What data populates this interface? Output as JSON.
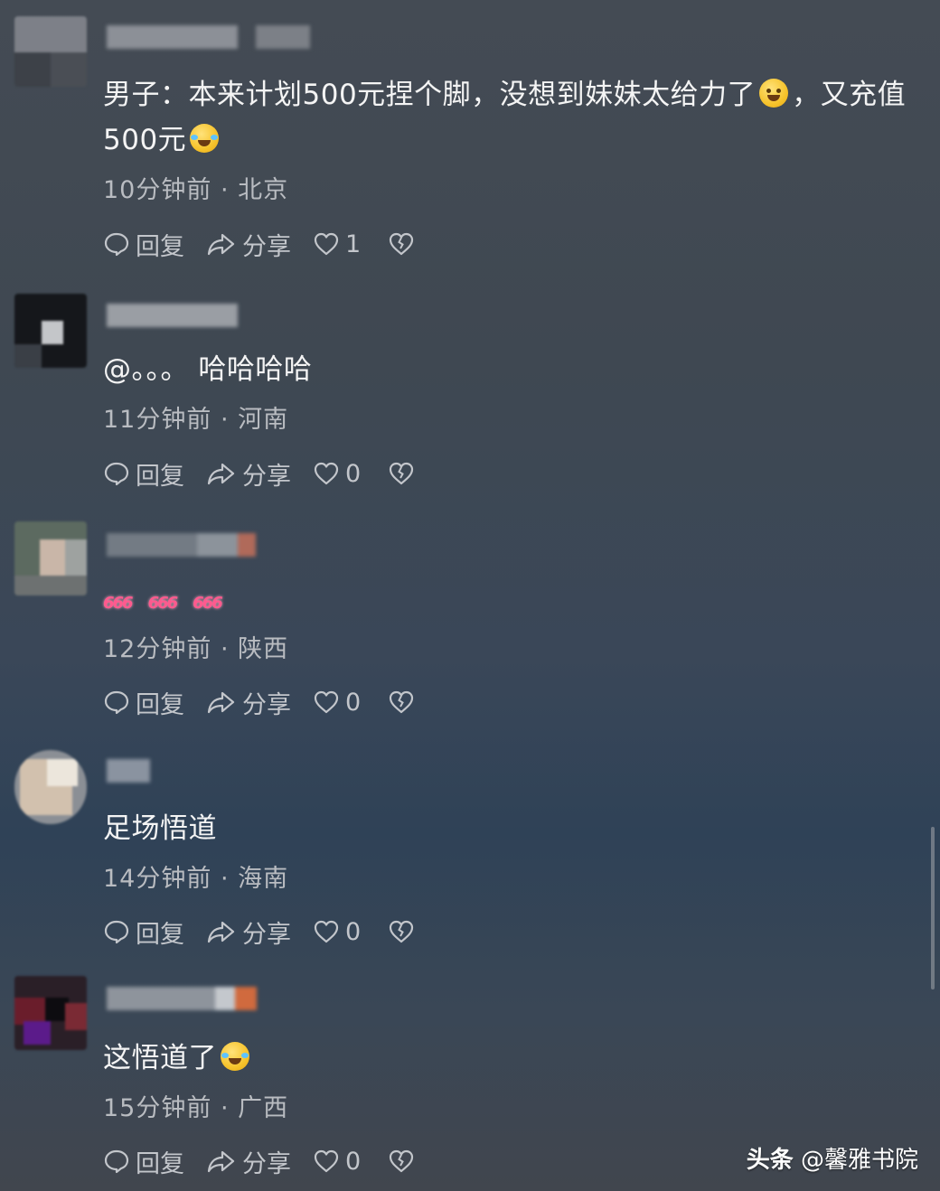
{
  "comments": [
    {
      "text": "男子：本来计划500元捏个脚，没想到妹妹太给力了",
      "text_tail": "，又充值500元",
      "emoji_mid": "sweat-smile-emoji",
      "emoji_end": "laugh-cry-emoji",
      "meta": "10分钟前 · 北京",
      "reply": "回复",
      "share": "分享",
      "likes": "1"
    },
    {
      "text": "@。。。 哈哈哈哈",
      "meta": "11分钟前 · 河南",
      "reply": "回复",
      "share": "分享",
      "likes": "0"
    },
    {
      "sticker": [
        "666",
        "666",
        "666"
      ],
      "meta": "12分钟前 · 陕西",
      "reply": "回复",
      "share": "分享",
      "likes": "0"
    },
    {
      "text": "足场悟道",
      "meta": "14分钟前 · 海南",
      "reply": "回复",
      "share": "分享",
      "likes": "0"
    },
    {
      "text": "这悟道了",
      "emoji_end": "laugh-cry-emoji",
      "meta": "15分钟前 · 广西",
      "reply": "回复",
      "share": "分享",
      "likes": "0"
    }
  ],
  "icons": {
    "reply": "speech-bubble-icon",
    "share": "share-arrow-icon",
    "like": "heart-icon",
    "dislike": "broken-heart-icon"
  },
  "watermark": {
    "brand": "头条",
    "account": "@馨雅书院"
  },
  "colors": {
    "accent_pink": "#ff5a8e",
    "meta_gray": "#b9bcc1"
  }
}
